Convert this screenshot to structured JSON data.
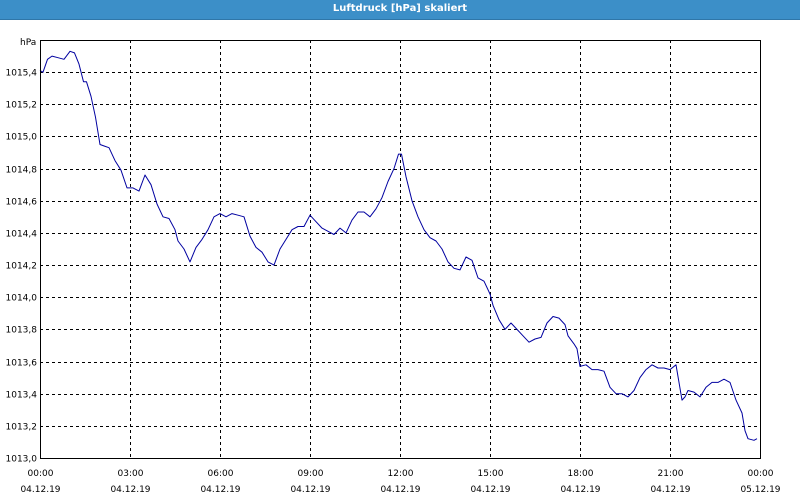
{
  "window": {
    "title": "Luftdruck [hPa] skaliert"
  },
  "chart_data": {
    "type": "line",
    "title": "Luftdruck [hPa] skaliert",
    "ylabel": "hPa",
    "xlabel": "",
    "ylim": [
      1013.0,
      1015.6
    ],
    "xlim": [
      0,
      24
    ],
    "grid": true,
    "line_color": "#0000a0",
    "grid_color": "#000000",
    "y_ticks": [
      {
        "value": 1015.4,
        "label": "1015,4"
      },
      {
        "value": 1015.2,
        "label": "1015,2"
      },
      {
        "value": 1015.0,
        "label": "1015,0"
      },
      {
        "value": 1014.8,
        "label": "1014,8"
      },
      {
        "value": 1014.6,
        "label": "1014,6"
      },
      {
        "value": 1014.4,
        "label": "1014,4"
      },
      {
        "value": 1014.2,
        "label": "1014,2"
      },
      {
        "value": 1014.0,
        "label": "1014,0"
      },
      {
        "value": 1013.8,
        "label": "1013,8"
      },
      {
        "value": 1013.6,
        "label": "1013,6"
      },
      {
        "value": 1013.4,
        "label": "1013,4"
      },
      {
        "value": 1013.2,
        "label": "1013,2"
      },
      {
        "value": 1013.0,
        "label": "1013,0"
      }
    ],
    "x_ticks": [
      {
        "value": 0,
        "time": "00:00",
        "date": "04.12.19"
      },
      {
        "value": 3,
        "time": "03:00",
        "date": "04.12.19"
      },
      {
        "value": 6,
        "time": "06:00",
        "date": "04.12.19"
      },
      {
        "value": 9,
        "time": "09:00",
        "date": "04.12.19"
      },
      {
        "value": 12,
        "time": "12:00",
        "date": "04.12.19"
      },
      {
        "value": 15,
        "time": "15:00",
        "date": "04.12.19"
      },
      {
        "value": 18,
        "time": "18:00",
        "date": "04.12.19"
      },
      {
        "value": 21,
        "time": "21:00",
        "date": "04.12.19"
      },
      {
        "value": 24,
        "time": "00:00",
        "date": "05.12.19"
      }
    ],
    "series": [
      {
        "points": [
          [
            0.0,
            1015.41
          ],
          [
            0.1,
            1015.4
          ],
          [
            0.25,
            1015.48
          ],
          [
            0.4,
            1015.5
          ],
          [
            0.6,
            1015.49
          ],
          [
            0.8,
            1015.48
          ],
          [
            1.0,
            1015.53
          ],
          [
            1.15,
            1015.52
          ],
          [
            1.3,
            1015.45
          ],
          [
            1.45,
            1015.34
          ],
          [
            1.55,
            1015.34
          ],
          [
            1.7,
            1015.25
          ],
          [
            1.85,
            1015.12
          ],
          [
            2.0,
            1014.95
          ],
          [
            2.15,
            1014.94
          ],
          [
            2.3,
            1014.93
          ],
          [
            2.5,
            1014.85
          ],
          [
            2.7,
            1014.79
          ],
          [
            2.9,
            1014.68
          ],
          [
            3.1,
            1014.68
          ],
          [
            3.3,
            1014.66
          ],
          [
            3.5,
            1014.76
          ],
          [
            3.7,
            1014.7
          ],
          [
            3.9,
            1014.58
          ],
          [
            4.1,
            1014.5
          ],
          [
            4.3,
            1014.49
          ],
          [
            4.5,
            1014.42
          ],
          [
            4.6,
            1014.35
          ],
          [
            4.8,
            1014.3
          ],
          [
            5.0,
            1014.22
          ],
          [
            5.2,
            1014.31
          ],
          [
            5.4,
            1014.36
          ],
          [
            5.6,
            1014.42
          ],
          [
            5.8,
            1014.5
          ],
          [
            6.0,
            1014.52
          ],
          [
            6.2,
            1014.5
          ],
          [
            6.4,
            1014.52
          ],
          [
            6.6,
            1014.51
          ],
          [
            6.8,
            1014.5
          ],
          [
            7.0,
            1014.38
          ],
          [
            7.2,
            1014.31
          ],
          [
            7.4,
            1014.28
          ],
          [
            7.6,
            1014.22
          ],
          [
            7.8,
            1014.2
          ],
          [
            8.0,
            1014.3
          ],
          [
            8.2,
            1014.36
          ],
          [
            8.4,
            1014.42
          ],
          [
            8.6,
            1014.44
          ],
          [
            8.8,
            1014.44
          ],
          [
            9.0,
            1014.51
          ],
          [
            9.2,
            1014.47
          ],
          [
            9.4,
            1014.43
          ],
          [
            9.6,
            1014.41
          ],
          [
            9.8,
            1014.39
          ],
          [
            10.0,
            1014.43
          ],
          [
            10.2,
            1014.4
          ],
          [
            10.4,
            1014.48
          ],
          [
            10.6,
            1014.53
          ],
          [
            10.8,
            1014.53
          ],
          [
            11.0,
            1014.5
          ],
          [
            11.2,
            1014.55
          ],
          [
            11.4,
            1014.62
          ],
          [
            11.6,
            1014.72
          ],
          [
            11.8,
            1014.8
          ],
          [
            11.95,
            1014.89
          ],
          [
            12.05,
            1014.89
          ],
          [
            12.2,
            1014.75
          ],
          [
            12.4,
            1014.6
          ],
          [
            12.6,
            1014.5
          ],
          [
            12.8,
            1014.42
          ],
          [
            13.0,
            1014.37
          ],
          [
            13.2,
            1014.35
          ],
          [
            13.4,
            1014.3
          ],
          [
            13.6,
            1014.22
          ],
          [
            13.8,
            1014.18
          ],
          [
            14.0,
            1014.17
          ],
          [
            14.2,
            1014.25
          ],
          [
            14.4,
            1014.23
          ],
          [
            14.6,
            1014.12
          ],
          [
            14.8,
            1014.1
          ],
          [
            15.0,
            1014.02
          ],
          [
            15.1,
            1013.95
          ],
          [
            15.3,
            1013.86
          ],
          [
            15.5,
            1013.8
          ],
          [
            15.7,
            1013.84
          ],
          [
            15.9,
            1013.8
          ],
          [
            16.1,
            1013.76
          ],
          [
            16.3,
            1013.72
          ],
          [
            16.5,
            1013.74
          ],
          [
            16.7,
            1013.75
          ],
          [
            16.9,
            1013.84
          ],
          [
            17.1,
            1013.88
          ],
          [
            17.3,
            1013.87
          ],
          [
            17.5,
            1013.83
          ],
          [
            17.6,
            1013.76
          ],
          [
            17.8,
            1013.71
          ],
          [
            17.9,
            1013.68
          ],
          [
            18.0,
            1013.57
          ],
          [
            18.2,
            1013.58
          ],
          [
            18.4,
            1013.55
          ],
          [
            18.6,
            1013.55
          ],
          [
            18.8,
            1013.54
          ],
          [
            19.0,
            1013.44
          ],
          [
            19.2,
            1013.4
          ],
          [
            19.4,
            1013.4
          ],
          [
            19.6,
            1013.38
          ],
          [
            19.8,
            1013.42
          ],
          [
            20.0,
            1013.5
          ],
          [
            20.2,
            1013.55
          ],
          [
            20.4,
            1013.58
          ],
          [
            20.6,
            1013.56
          ],
          [
            20.8,
            1013.56
          ],
          [
            21.0,
            1013.55
          ],
          [
            21.2,
            1013.58
          ],
          [
            21.3,
            1013.47
          ],
          [
            21.4,
            1013.36
          ],
          [
            21.5,
            1013.38
          ],
          [
            21.6,
            1013.42
          ],
          [
            21.8,
            1013.41
          ],
          [
            22.0,
            1013.38
          ],
          [
            22.2,
            1013.44
          ],
          [
            22.4,
            1013.47
          ],
          [
            22.6,
            1013.47
          ],
          [
            22.8,
            1013.49
          ],
          [
            23.0,
            1013.47
          ],
          [
            23.2,
            1013.36
          ],
          [
            23.4,
            1013.28
          ],
          [
            23.5,
            1013.17
          ],
          [
            23.6,
            1013.12
          ],
          [
            23.8,
            1013.11
          ],
          [
            23.9,
            1013.12
          ]
        ]
      }
    ]
  }
}
